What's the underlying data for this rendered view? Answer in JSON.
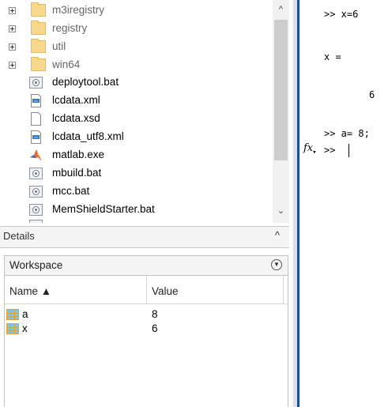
{
  "file_browser": {
    "items": [
      {
        "name": "m3iregistry",
        "type": "folder",
        "expandable": true
      },
      {
        "name": "registry",
        "type": "folder",
        "expandable": true
      },
      {
        "name": "util",
        "type": "folder",
        "expandable": true
      },
      {
        "name": "win64",
        "type": "folder",
        "expandable": true
      },
      {
        "name": "deploytool.bat",
        "type": "batch-file"
      },
      {
        "name": "lcdata.xml",
        "type": "xml-file"
      },
      {
        "name": "lcdata.xsd",
        "type": "plain-file"
      },
      {
        "name": "lcdata_utf8.xml",
        "type": "xml-file"
      },
      {
        "name": "matlab.exe",
        "type": "matlab-executable"
      },
      {
        "name": "mbuild.bat",
        "type": "batch-file"
      },
      {
        "name": "mcc.bat",
        "type": "batch-file"
      },
      {
        "name": "MemShieldStarter.bat",
        "type": "batch-file"
      }
    ]
  },
  "details": {
    "label": "Details",
    "caret": "^"
  },
  "workspace": {
    "title": "Workspace",
    "columns": {
      "name": "Name ▲",
      "value": "Value"
    },
    "variables": [
      {
        "name": "a",
        "value": "8"
      },
      {
        "name": "x",
        "value": "6"
      }
    ]
  },
  "command_window": {
    "lines": [
      ">> x=6",
      "x =",
      "6",
      ">> a= 8;",
      ">> "
    ],
    "fx_label": "fx",
    "colors": {
      "accent": "#1f4e8c"
    }
  }
}
